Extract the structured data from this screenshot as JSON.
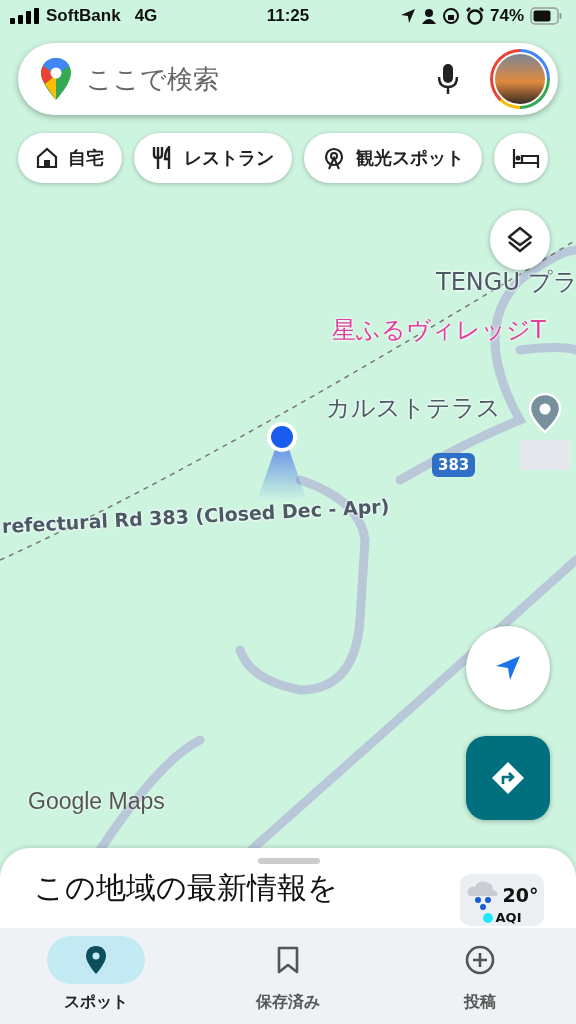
{
  "status_bar": {
    "carrier": "SoftBank",
    "network": "4G",
    "time": "11:25",
    "battery": "74%"
  },
  "search": {
    "placeholder": "ここで検索"
  },
  "chips": [
    {
      "kind": "home",
      "label": "自宅"
    },
    {
      "kind": "restaurant",
      "label": "レストラン"
    },
    {
      "kind": "sights",
      "label": "観光スポット"
    },
    {
      "kind": "hotel"
    }
  ],
  "map": {
    "labels": [
      {
        "kind": "place",
        "text": "TENGU プラ"
      },
      {
        "kind": "poi",
        "text": "星ふるヴィレッジT"
      },
      {
        "kind": "pin",
        "text": "カルストテラス"
      }
    ],
    "road_shield": "383",
    "road_name": "refectural Rd 383 (Closed Dec - Apr)",
    "watermark": "Google Maps"
  },
  "sheet": {
    "headline": "この地域の最新情報を",
    "temperature": "20°",
    "aqi": "AQI"
  },
  "nav": [
    {
      "kind": "spot",
      "label": "スポット",
      "selected": true
    },
    {
      "kind": "saved",
      "label": "保存済み",
      "selected": false
    },
    {
      "kind": "post",
      "label": "投稿",
      "selected": false
    }
  ]
}
